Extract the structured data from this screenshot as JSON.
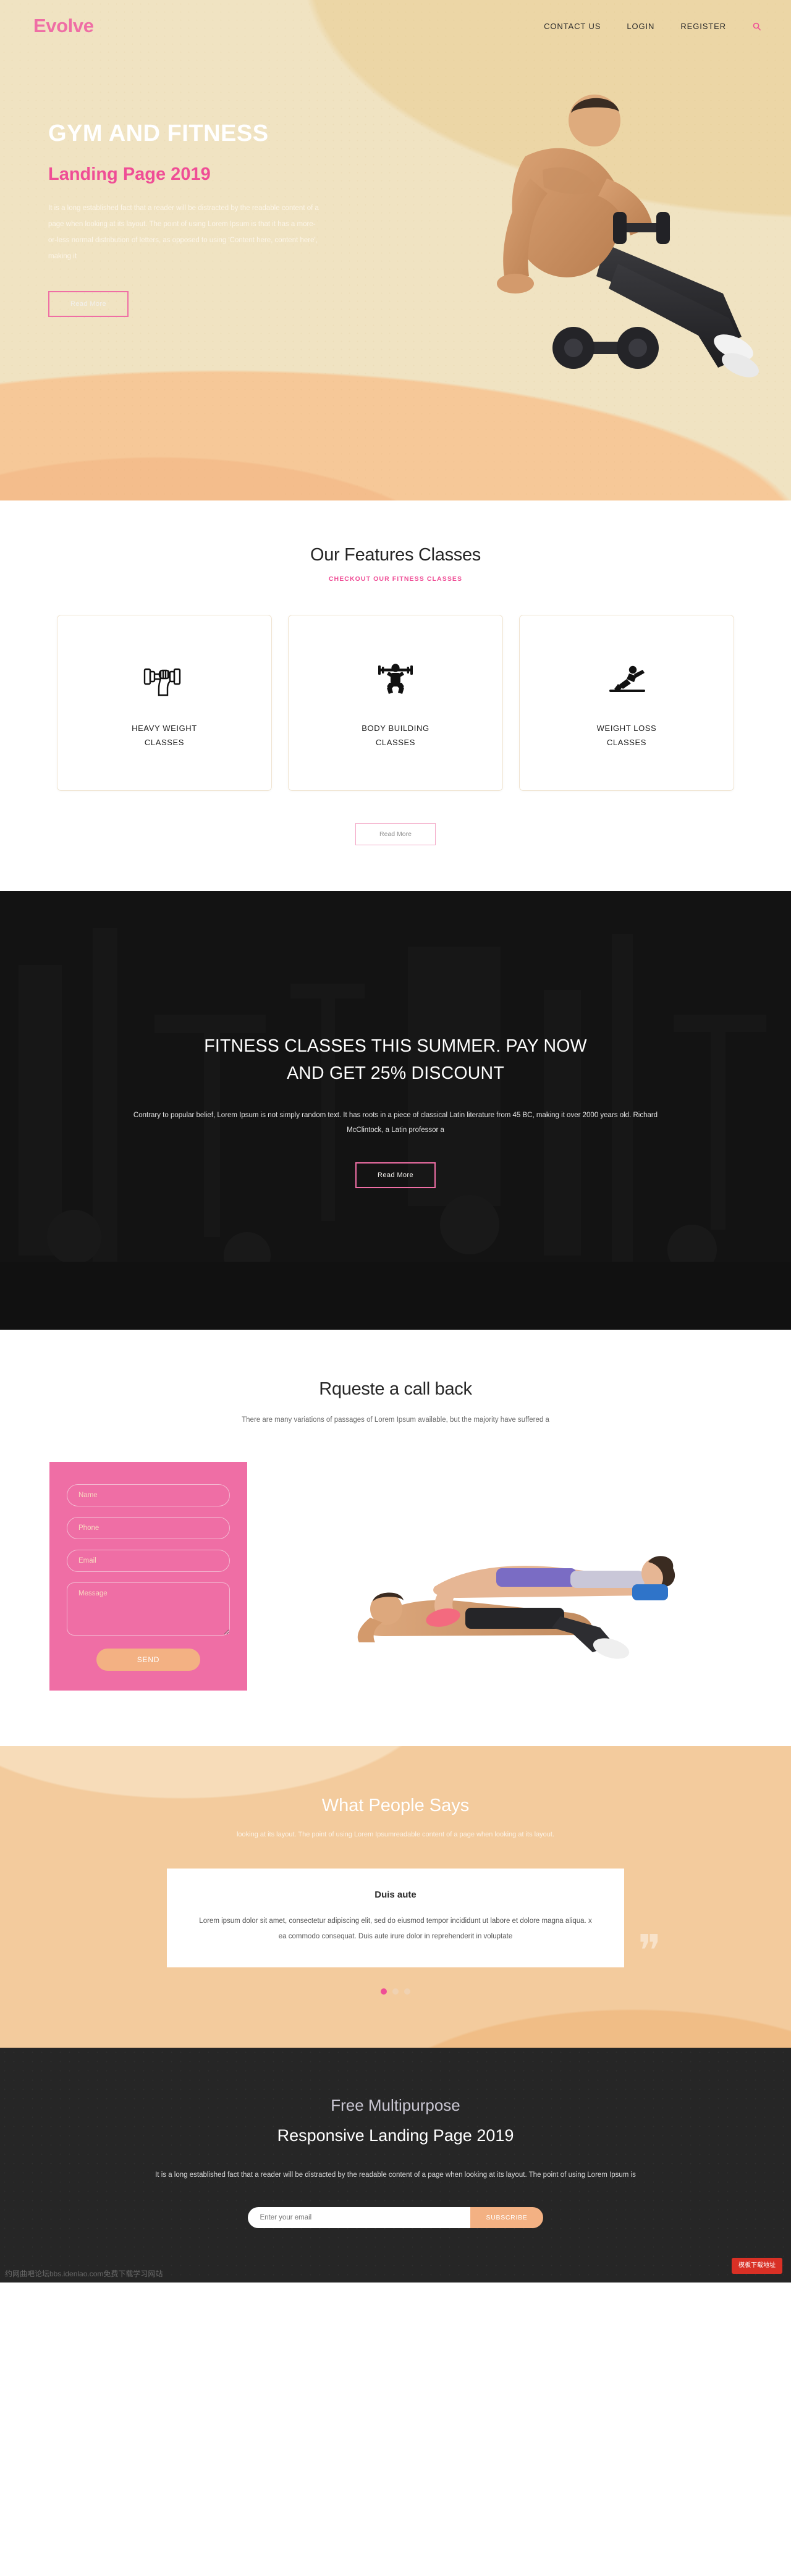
{
  "brand": {
    "logo": "Evolve",
    "accent_pink": "#ef4e96",
    "accent_peach": "#f3b183",
    "cream": "#f0e3c2"
  },
  "nav": {
    "items": [
      {
        "label": "CONTACT US"
      },
      {
        "label": "LOGIN"
      },
      {
        "label": "REGISTER"
      }
    ],
    "search_icon": "search-icon"
  },
  "hero": {
    "title": "GYM AND FITNESS",
    "subtitle": "Landing Page 2019",
    "body": "It is a long established fact that a reader will be distracted by the readable content of a page when looking at its layout. The point of using Lorem Ipsum is that it has a more-or-less normal distribution of letters, as opposed to using 'Content here, content here', making it",
    "cta": "Read More"
  },
  "features": {
    "title": "Our Features Classes",
    "kicker": "CHECKOUT OUR FITNESS CLASSES",
    "cards": [
      {
        "icon": "dumbbell-hand-icon",
        "line1": "HEAVY WEIGHT",
        "line2": "CLASSES"
      },
      {
        "icon": "barbell-squat-icon",
        "line1": "BODY BUILDING",
        "line2": "CLASSES"
      },
      {
        "icon": "situp-icon",
        "line1": "WEIGHT LOSS",
        "line2": "CLASSES"
      }
    ],
    "cta": "Read More"
  },
  "banner": {
    "title_line1": "FITNESS CLASSES THIS SUMMER. PAY NOW",
    "title_line2": "AND GET 25% DISCOUNT",
    "body": "Contrary to popular belief, Lorem Ipsum is not simply random text. It has roots in a piece of classical Latin literature from 45 BC, making it over 2000 years old. Richard McClintock, a Latin professor a",
    "cta": "Read More"
  },
  "callback": {
    "title": "Rqueste a call back",
    "body": "There are many variations of passages of Lorem Ipsum available, but the majority have suffered a",
    "form": {
      "name_placeholder": "Name",
      "phone_placeholder": "Phone",
      "email_placeholder": "Email",
      "message_placeholder": "Message",
      "name_value": "",
      "phone_value": "",
      "email_value": "",
      "message_value": "",
      "send_label": "SEND"
    }
  },
  "testimonials": {
    "title": "What People Says",
    "subtitle": "looking at its layout. The point of using Lorem Ipsumreadable content of a page when looking at its layout.",
    "card": {
      "name": "Duis aute",
      "quote": "Lorem ipsum dolor sit amet, consectetur adipiscing elit, sed do eiusmod tempor incididunt ut labore et dolore magna aliqua. x ea commodo consequat. Duis aute irure dolor in reprehenderit in voluptate"
    },
    "dots": [
      {
        "active": true
      },
      {
        "active": false
      },
      {
        "active": false
      }
    ]
  },
  "footer": {
    "kicker": "Free Multipurpose",
    "title": "Responsive Landing Page 2019",
    "body": "It is a long established fact that a reader will be distracted by the readable content of a page when looking at its layout. The point of using Lorem Ipsum is",
    "subscribe": {
      "placeholder": "Enter your email",
      "value": "",
      "button": "SUBSCRIBE"
    },
    "watermark": "约网曲吧论坛bbs.idenlao.com免费下载学习网站",
    "red_badge": "模板下载地址"
  }
}
